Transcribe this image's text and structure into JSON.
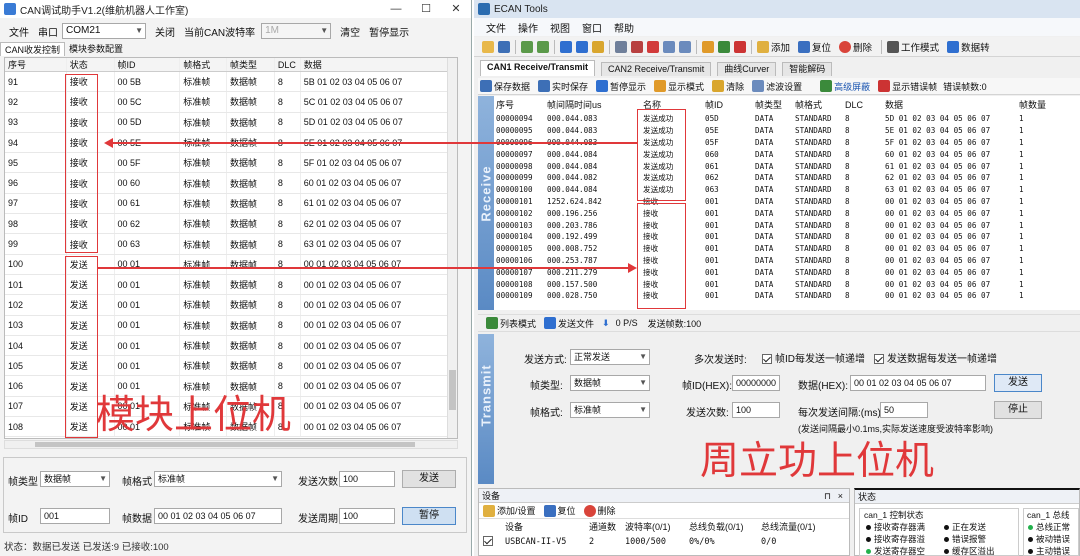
{
  "left": {
    "title": "CAN调试助手V1.2(维航机器人工作室)",
    "menu_file": "文件",
    "port_label": "串口",
    "port_value": "COM21",
    "close_btn": "关闭",
    "baud_label": "当前CAN波特率",
    "baud_value": "1M",
    "clear_btn": "清空",
    "pause_btn": "暂停显示",
    "tabs": [
      "CAN收发控制",
      "模块参数配置"
    ],
    "columns": [
      "序号",
      "状态",
      "帧ID",
      "帧格式",
      "帧类型",
      "DLC",
      "数据"
    ],
    "rows": [
      [
        "91",
        "接收",
        "00 5B",
        "标准帧",
        "数据帧",
        "8",
        "5B 01 02 03 04 05 06 07"
      ],
      [
        "92",
        "接收",
        "00 5C",
        "标准帧",
        "数据帧",
        "8",
        "5C 01 02 03 04 05 06 07"
      ],
      [
        "93",
        "接收",
        "00 5D",
        "标准帧",
        "数据帧",
        "8",
        "5D 01 02 03 04 05 06 07"
      ],
      [
        "94",
        "接收",
        "00 5E",
        "标准帧",
        "数据帧",
        "8",
        "5E 01 02 03 04 05 06 07"
      ],
      [
        "95",
        "接收",
        "00 5F",
        "标准帧",
        "数据帧",
        "8",
        "5F 01 02 03 04 05 06 07"
      ],
      [
        "96",
        "接收",
        "00 60",
        "标准帧",
        "数据帧",
        "8",
        "60 01 02 03 04 05 06 07"
      ],
      [
        "97",
        "接收",
        "00 61",
        "标准帧",
        "数据帧",
        "8",
        "61 01 02 03 04 05 06 07"
      ],
      [
        "98",
        "接收",
        "00 62",
        "标准帧",
        "数据帧",
        "8",
        "62 01 02 03 04 05 06 07"
      ],
      [
        "99",
        "接收",
        "00 63",
        "标准帧",
        "数据帧",
        "8",
        "63 01 02 03 04 05 06 07"
      ],
      [
        "100",
        "发送",
        "00 01",
        "标准帧",
        "数据帧",
        "8",
        "00 01 02 03 04 05 06 07"
      ],
      [
        "101",
        "发送",
        "00 01",
        "标准帧",
        "数据帧",
        "8",
        "00 01 02 03 04 05 06 07"
      ],
      [
        "102",
        "发送",
        "00 01",
        "标准帧",
        "数据帧",
        "8",
        "00 01 02 03 04 05 06 07"
      ],
      [
        "103",
        "发送",
        "00 01",
        "标准帧",
        "数据帧",
        "8",
        "00 01 02 03 04 05 06 07"
      ],
      [
        "104",
        "发送",
        "00 01",
        "标准帧",
        "数据帧",
        "8",
        "00 01 02 03 04 05 06 07"
      ],
      [
        "105",
        "发送",
        "00 01",
        "标准帧",
        "数据帧",
        "8",
        "00 01 02 03 04 05 06 07"
      ],
      [
        "106",
        "发送",
        "00 01",
        "标准帧",
        "数据帧",
        "8",
        "00 01 02 03 04 05 06 07"
      ],
      [
        "107",
        "发送",
        "00 01",
        "标准帧",
        "数据帧",
        "8",
        "00 01 02 03 04 05 06 07"
      ],
      [
        "108",
        "发送",
        "00 01",
        "标准帧",
        "数据帧",
        "8",
        "00 01 02 03 04 05 06 07"
      ]
    ],
    "send": {
      "frame_type_label": "帧类型",
      "frame_type_value": "数据帧",
      "frame_format_label": "帧格式",
      "frame_format_value": "标准帧",
      "send_count_label": "发送次数",
      "send_count_value": "100",
      "send_btn": "发送",
      "frame_id_label": "帧ID",
      "frame_id_value": "001",
      "data_label": "帧数据",
      "data_value": "00 01 02 03 04 05 06 07",
      "period_label": "发送周期",
      "period_value": "100",
      "pause_btn": "暂停"
    },
    "status": "状态：数据已发送   已发送:9   已接收:100"
  },
  "right": {
    "title": "ECAN Tools",
    "menus": [
      "文件",
      "操作",
      "视图",
      "窗口",
      "帮助"
    ],
    "toolbar": {
      "add": "添加",
      "reset": "复位",
      "delete": "删除",
      "work_mode": "工作模式",
      "data_convert": "数据转"
    },
    "tabs": [
      "CAN1 Receive/Transmit",
      "CAN2 Receive/Transmit",
      "曲线Curver",
      "智能解码"
    ],
    "toolbar2": {
      "save": "保存数据",
      "realtime_save": "实时保存",
      "pause": "暂停显示",
      "display_mode": "显示模式",
      "clear": "清除",
      "filter": "滤波设置",
      "advanced": "高级屏蔽",
      "show_error": "显示错误帧",
      "error_frames": "错误帧数:0"
    },
    "receive_label": "Receive",
    "columns": [
      "序号",
      "帧间隔时间us",
      "名称",
      "帧ID",
      "帧类型",
      "帧格式",
      "DLC",
      "数据",
      "帧数量"
    ],
    "rows": [
      [
        "00000094",
        "000.044.083",
        "发送成功",
        "05D",
        "DATA",
        "STANDARD",
        "8",
        "5D 01 02 03 04 05 06 07",
        "1"
      ],
      [
        "00000095",
        "000.044.083",
        "发送成功",
        "05E",
        "DATA",
        "STANDARD",
        "8",
        "5E 01 02 03 04 05 06 07",
        "1"
      ],
      [
        "00000096",
        "000.044.083",
        "发送成功",
        "05F",
        "DATA",
        "STANDARD",
        "8",
        "5F 01 02 03 04 05 06 07",
        "1"
      ],
      [
        "00000097",
        "000.044.084",
        "发送成功",
        "060",
        "DATA",
        "STANDARD",
        "8",
        "60 01 02 03 04 05 06 07",
        "1"
      ],
      [
        "00000098",
        "000.044.084",
        "发送成功",
        "061",
        "DATA",
        "STANDARD",
        "8",
        "61 01 02 03 04 05 06 07",
        "1"
      ],
      [
        "00000099",
        "000.044.082",
        "发送成功",
        "062",
        "DATA",
        "STANDARD",
        "8",
        "62 01 02 03 04 05 06 07",
        "1"
      ],
      [
        "00000100",
        "000.044.084",
        "发送成功",
        "063",
        "DATA",
        "STANDARD",
        "8",
        "63 01 02 03 04 05 06 07",
        "1"
      ],
      [
        "00000101",
        "1252.624.842",
        "接收",
        "001",
        "DATA",
        "STANDARD",
        "8",
        "00 01 02 03 04 05 06 07",
        "1"
      ],
      [
        "00000102",
        "000.196.256",
        "接收",
        "001",
        "DATA",
        "STANDARD",
        "8",
        "00 01 02 03 04 05 06 07",
        "1"
      ],
      [
        "00000103",
        "000.203.786",
        "接收",
        "001",
        "DATA",
        "STANDARD",
        "8",
        "00 01 02 03 04 05 06 07",
        "1"
      ],
      [
        "00000104",
        "000.192.499",
        "接收",
        "001",
        "DATA",
        "STANDARD",
        "8",
        "00 01 02 03 04 05 06 07",
        "1"
      ],
      [
        "00000105",
        "000.008.752",
        "接收",
        "001",
        "DATA",
        "STANDARD",
        "8",
        "00 01 02 03 04 05 06 07",
        "1"
      ],
      [
        "00000106",
        "000.253.787",
        "接收",
        "001",
        "DATA",
        "STANDARD",
        "8",
        "00 01 02 03 04 05 06 07",
        "1"
      ],
      [
        "00000107",
        "000.211.279",
        "接收",
        "001",
        "DATA",
        "STANDARD",
        "8",
        "00 01 02 03 04 05 06 07",
        "1"
      ],
      [
        "00000108",
        "000.157.500",
        "接收",
        "001",
        "DATA",
        "STANDARD",
        "8",
        "00 01 02 03 04 05 06 07",
        "1"
      ],
      [
        "00000109",
        "000.028.750",
        "接收",
        "001",
        "DATA",
        "STANDARD",
        "8",
        "00 01 02 03 04 05 06 07",
        "1"
      ]
    ],
    "status_bar": {
      "list_mode": "列表模式",
      "send_file": "发送文件",
      "rate": "0 P/S",
      "sent_count": "发送帧数:100"
    },
    "transmit_label": "Transmit",
    "transmit": {
      "send_mode_label": "发送方式:",
      "send_mode_value": "正常发送",
      "multi_label": "多次发送时:",
      "id_inc": "帧ID每发送一帧递增",
      "data_inc": "发送数据每发送一帧递增",
      "frame_type_label": "帧类型:",
      "frame_type_value": "数据帧",
      "frame_id_label": "帧ID(HEX):",
      "frame_id_value": "00000000",
      "data_label": "数据(HEX):",
      "data_value": "00 01 02 03 04 05 06 07",
      "send_btn": "发送",
      "frame_format_label": "帧格式:",
      "frame_format_value": "标准帧",
      "send_count_label": "发送次数:",
      "send_count_value": "100",
      "interval_label": "每次发送间隔:(ms)",
      "interval_value": "50",
      "stop_btn": "停止",
      "note": "(发送间隔最小0.1ms,实际发送速度受波特率影响)"
    },
    "device_panel": {
      "title": "设备",
      "add": "添加/设置",
      "reset": "复位",
      "delete": "删除",
      "columns": [
        "设备",
        "通道数",
        "波特率(0/1)",
        "总线负载(0/1)",
        "总线流量(0/1)"
      ],
      "row": [
        "USBCAN-II-V5",
        "2",
        "1000/500",
        "0%/0%",
        "0/0"
      ]
    },
    "status_panel": {
      "title": "状态",
      "group1": "can_1 控制状态",
      "group2": "can_1 总线",
      "items": [
        "接收寄存器满",
        "正在发送",
        "接收寄存器溢",
        "错误报警",
        "发送寄存器空",
        "缓存区溢出"
      ],
      "items2": [
        "总线正常",
        "被动错误",
        "主动错误"
      ]
    }
  },
  "annotations": {
    "left_label": "模块上位机",
    "right_label": "周立功上位机"
  },
  "colors": {
    "annotation_red": "#e0383a",
    "receive_band": "#6f9bd0",
    "status_green": "#22b14c"
  }
}
